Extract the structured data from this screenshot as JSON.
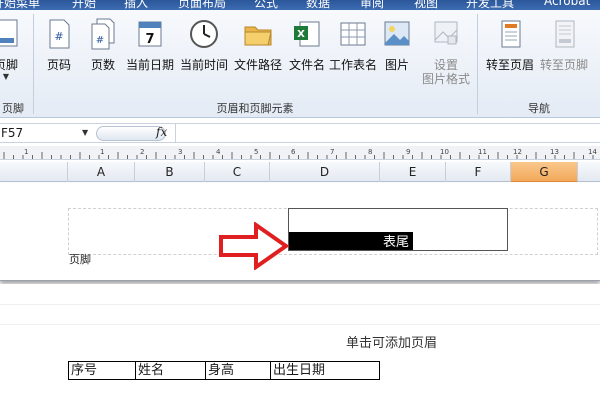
{
  "tabs": [
    "开始菜单",
    "开始",
    "插入",
    "页面布局",
    "公式",
    "数据",
    "审阅",
    "视图",
    "开发工具",
    "Acrobat"
  ],
  "ribbon": {
    "group_left_label": "页脚",
    "buttons_left": [
      {
        "label": "页脚",
        "icon": "footer-icon"
      }
    ],
    "elements_group": {
      "label": "页眉和页脚元素",
      "buttons": [
        {
          "label": "页码",
          "icon": "page-number-icon"
        },
        {
          "label": "页数",
          "icon": "page-count-icon"
        },
        {
          "label": "当前日期",
          "icon": "calendar-icon"
        },
        {
          "label": "当前时间",
          "icon": "clock-icon"
        },
        {
          "label": "文件路径",
          "icon": "folder-icon"
        },
        {
          "label": "文件名",
          "icon": "excel-file-icon"
        },
        {
          "label": "工作表名",
          "icon": "sheet-grid-icon"
        },
        {
          "label": "图片",
          "icon": "picture-icon"
        },
        {
          "label": "设置\n图片格式",
          "icon": "format-picture-icon",
          "disabled": true
        }
      ]
    },
    "nav_group": {
      "label": "导航",
      "buttons": [
        {
          "label": "转至页眉",
          "icon": "goto-header-icon"
        },
        {
          "label": "转至页脚",
          "icon": "goto-footer-icon",
          "disabled": true
        }
      ]
    }
  },
  "formula_bar": {
    "name_box": "F57",
    "fx": "fx",
    "formula": ""
  },
  "ruler_marks": [
    "1",
    "1",
    "2",
    "3",
    "4",
    "5",
    "6",
    "7",
    "8",
    "9",
    "10",
    "11",
    "12",
    "13",
    "14"
  ],
  "columns": [
    "A",
    "B",
    "C",
    "D",
    "E",
    "F",
    "G"
  ],
  "active_column": "G",
  "footer": {
    "label": "页脚",
    "content": "表尾"
  },
  "header_hint": "单击可添加页眉",
  "table_header": [
    "序号",
    "姓名",
    "身高",
    "出生日期"
  ],
  "colors": {
    "accent": "#2b579a",
    "active_column": "#f3a85a",
    "arrow": "#e02020"
  }
}
